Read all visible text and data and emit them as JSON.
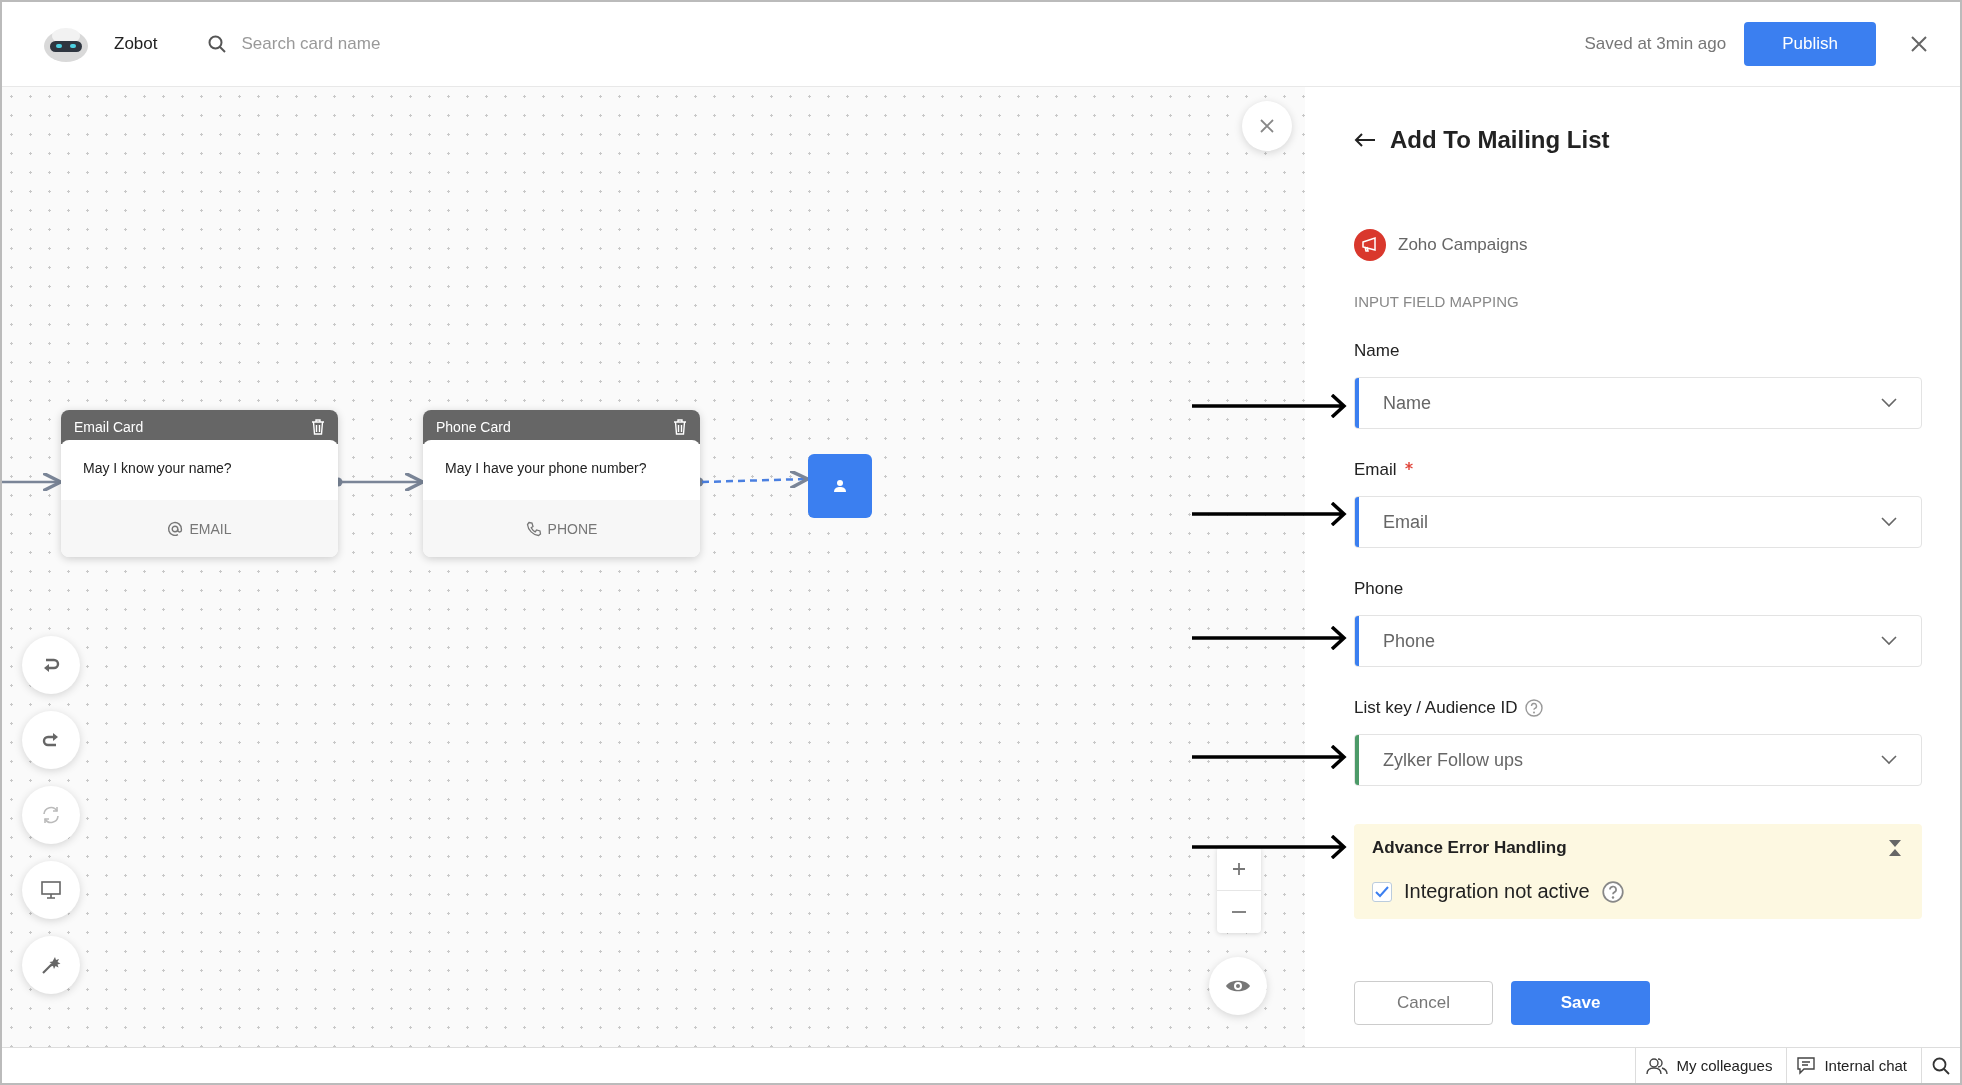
{
  "header": {
    "app_name": "Zobot",
    "search": {
      "placeholder": "Search card name"
    },
    "saved_status": "Saved at 3min ago",
    "publish_button": "Publish"
  },
  "canvas": {
    "cards": [
      {
        "title": "Email Card",
        "question": "May I know your name?",
        "input": {
          "kind": "email",
          "label": "EMAIL"
        }
      },
      {
        "title": "Phone Card",
        "question": "May I have your phone number?",
        "input": {
          "kind": "phone",
          "label": "PHONE"
        }
      }
    ],
    "tools": [
      {
        "kind": "undo",
        "disabled": false
      },
      {
        "kind": "redo",
        "disabled": false
      },
      {
        "kind": "refresh",
        "disabled": true
      },
      {
        "kind": "preview",
        "disabled": false
      },
      {
        "kind": "magic",
        "disabled": false
      }
    ]
  },
  "panel": {
    "title": "Add To Mailing List",
    "integration": "Zoho Campaigns",
    "section_label": "INPUT FIELD MAPPING",
    "fields": [
      {
        "label": "Name",
        "required": false,
        "help": false,
        "value": "Name",
        "color": "#3b7ff0"
      },
      {
        "label": "Email",
        "required": true,
        "help": false,
        "value": "Email",
        "color": "#3b7ff0"
      },
      {
        "label": "Phone",
        "required": false,
        "help": false,
        "value": "Phone",
        "color": "#3b7ff0"
      },
      {
        "label": "List key / Audience ID",
        "required": false,
        "help": true,
        "value": "Zylker Follow ups",
        "color": "#4c9a68"
      }
    ],
    "error_handling": {
      "title": "Advance Error Handling",
      "options": [
        {
          "label": "Integration not active",
          "checked": true,
          "help": true
        }
      ]
    },
    "buttons": [
      {
        "kind": "secondary",
        "label": "Cancel"
      },
      {
        "kind": "primary",
        "label": "Save"
      }
    ]
  },
  "footer": {
    "items": [
      {
        "kind": "colleagues",
        "label": "My colleagues"
      },
      {
        "kind": "chat",
        "label": "Internal chat"
      }
    ]
  }
}
